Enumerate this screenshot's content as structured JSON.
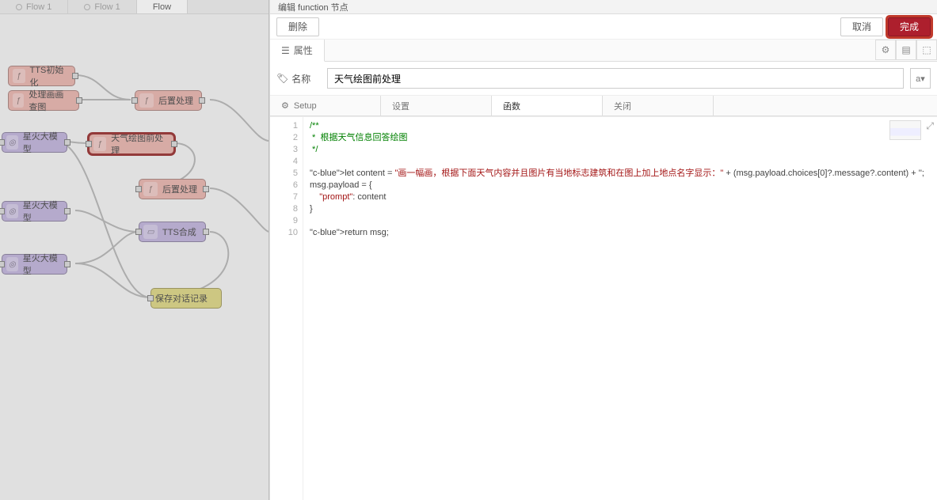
{
  "flow_tabs": [
    {
      "label": "Flow 1"
    },
    {
      "label": "Flow 1"
    },
    {
      "label": "Flow"
    }
  ],
  "nodes": {
    "tts_init": "TTS初始化",
    "process_img": "处理画画查图",
    "post1": "后置处理",
    "model1": "星火大模型",
    "weather_pre": "天气绘图前处理",
    "post2": "后置处理",
    "model2": "星火大模型",
    "tts_syn": "TTS合成",
    "model3": "星火大模型",
    "save": "保存对话记录"
  },
  "panel_title": "编辑 function 节点",
  "actions": {
    "delete": "删除",
    "cancel": "取消",
    "done": "完成"
  },
  "main_tab": "属性",
  "name_label": "名称",
  "name_value": "天气绘图前处理",
  "lang_btn": "a▾",
  "sub_tabs": {
    "setup": "Setup",
    "settings": "设置",
    "function": "函数",
    "close": "关闭"
  },
  "code_lines": [
    "/**",
    " *  根据天气信息回答绘图",
    " */",
    "",
    "let content = \"画一幅画，根据下面天气内容并且图片有当地标志建筑和在图上加上地点名字显示：\" + (msg.payload.choices[0]?.message?.content) + '';",
    "msg.payload = {",
    "    \"prompt\": content",
    "}",
    "",
    "return msg;"
  ],
  "icons": {
    "gear": "⚙",
    "tag": "🏷",
    "book": "▤",
    "chart": "⬚"
  }
}
